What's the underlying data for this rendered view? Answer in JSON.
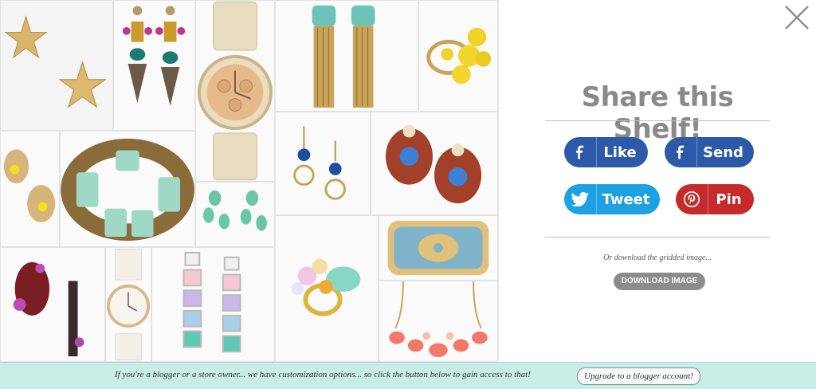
{
  "grid": {
    "tiles": [
      {
        "name": "starfish-earrings"
      },
      {
        "name": "skull-drop-earrings"
      },
      {
        "name": "gold-watch"
      },
      {
        "name": "turquoise-fringe-earrings"
      },
      {
        "name": "yellow-cluster-ring"
      },
      {
        "name": "flower-earrings"
      },
      {
        "name": "mint-bracelet"
      },
      {
        "name": "blue-hoop-earrings"
      },
      {
        "name": "jeweled-beetle-earrings"
      },
      {
        "name": "mint-drop-earrings"
      },
      {
        "name": "red-crystal-brooch"
      },
      {
        "name": "white-watch"
      },
      {
        "name": "pastel-square-earrings"
      },
      {
        "name": "cocktail-ring"
      },
      {
        "name": "blue-cuff"
      },
      {
        "name": "coral-necklace"
      }
    ]
  },
  "share": {
    "title": "Share this Shelf!",
    "buttons": {
      "facebook_like": "Like",
      "facebook_send": "Send",
      "twitter_tweet": "Tweet",
      "pinterest_pin": "Pin"
    },
    "or_text": "Or download the gridded image...",
    "download_label": "DOWNLOAD IMAGE"
  },
  "bottom_bar": {
    "message": "If you're a blogger or a store owner... we have customization options... so click the button below to gain access to that!",
    "upgrade_label": "Upgrade to a blogger account!"
  },
  "colors": {
    "facebook": "#2d5aa8",
    "twitter": "#1da1e3",
    "pinterest": "#c62a2c",
    "bottom_bar_bg": "#c8ede6",
    "title_gray": "#8a8a8a"
  },
  "icons": {
    "close": "close-icon",
    "facebook": "facebook-icon",
    "twitter": "twitter-icon",
    "pinterest": "pinterest-icon"
  }
}
